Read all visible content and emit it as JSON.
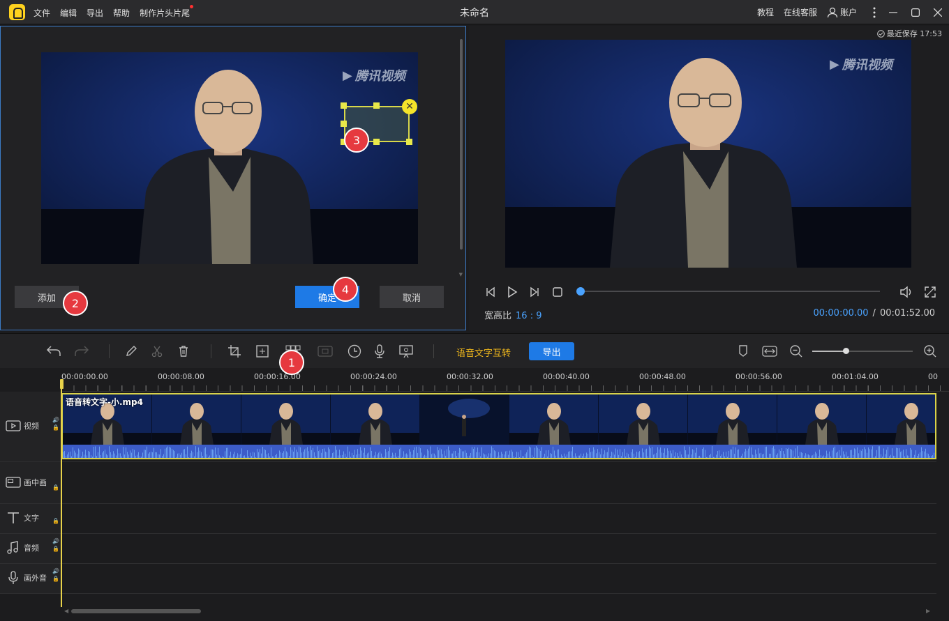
{
  "app": {
    "menu": [
      "文件",
      "编辑",
      "导出",
      "帮助",
      "制作片头片尾"
    ],
    "title": "未命名",
    "tutorial": "教程",
    "support": "在线客服",
    "account": "账户"
  },
  "editor": {
    "watermark": "腾讯视频",
    "add_label": "添加",
    "confirm_label": "确定",
    "cancel_label": "取消"
  },
  "preview": {
    "last_saved": "最近保存 17:53",
    "watermark": "腾讯视频",
    "aspect_label": "宽高比",
    "aspect_value": "16 : 9",
    "current_time": "00:00:00.00",
    "separator": "/",
    "total_time": "00:01:52.00",
    "progress": 0
  },
  "toolbar": {
    "speech_text": "语音文字互转",
    "export_label": "导出",
    "zoom_level": 0.33
  },
  "timeline": {
    "ruler": [
      "00:00:00.00",
      "00:00:08.00",
      "00:00:16.00",
      "00:00:24.00",
      "00:00:32.00",
      "00:00:40.00",
      "00:00:48.00",
      "00:00:56.00",
      "00:01:04.00",
      "00"
    ],
    "tracks": {
      "video": "视频",
      "pip": "画中画",
      "text": "文字",
      "audio": "音频",
      "voiceover": "画外音"
    },
    "clip_name": "语音转文字-小.mp4"
  },
  "annotations": [
    "1",
    "2",
    "3",
    "4"
  ],
  "colors": {
    "accent": "#1e7ae6",
    "highlight": "#f0b81c",
    "badge": "#e6393f",
    "selection": "#d8d84a"
  }
}
